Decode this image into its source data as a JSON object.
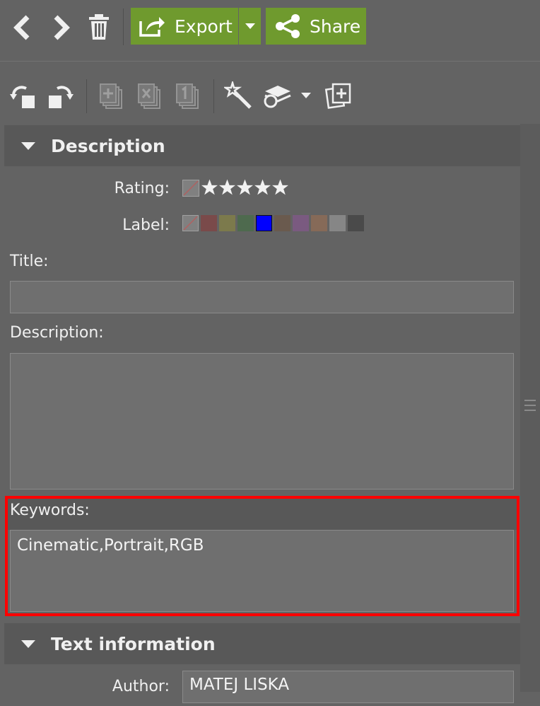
{
  "toolbar": {
    "back_icon": "chevron-left-icon",
    "forward_icon": "chevron-right-icon",
    "delete_icon": "trash-icon",
    "export_label": "Export",
    "share_label": "Share",
    "accent_color": "#6f9a2e"
  },
  "secondary_toolbar": {
    "icons": [
      "rotate-left-icon",
      "rotate-right-icon",
      "add-copy-icon",
      "remove-copy-icon",
      "numbered-copy-icon",
      "magic-wand-icon",
      "layers-icon",
      "dropdown-arrow-icon",
      "new-version-icon"
    ]
  },
  "description_section": {
    "title": "Description",
    "rating_label": "Rating:",
    "rating_value": 0,
    "rating_max": 5,
    "label_label": "Label:",
    "label_colors": [
      "none",
      "#7a4a4a",
      "#7c7a4c",
      "#4e6a4e",
      "#0000ff",
      "#6a5a4e",
      "#7a5a80",
      "#866a58",
      "#868686",
      "#4a4a4a"
    ],
    "selected_label_color": "#0000ff",
    "title_field_label": "Title:",
    "title_value": "",
    "description_field_label": "Description:",
    "description_value": "",
    "keywords_label": "Keywords:",
    "keywords_value": "Cinematic,Portrait,RGB"
  },
  "text_info_section": {
    "title": "Text information",
    "author_label": "Author:",
    "author_value": "MATEJ LISKA"
  },
  "highlight_color": "#ff0000"
}
